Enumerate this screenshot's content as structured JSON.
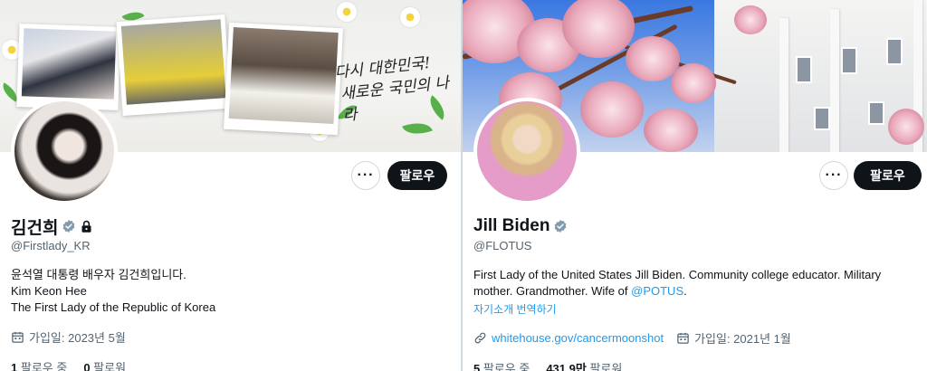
{
  "left_profile": {
    "banner": {
      "slogan_line1": "다시 대한민국!",
      "slogan_line2": "새로운 국민의 나라"
    },
    "follow_label": "팔로우",
    "more_label": "···",
    "name": "김건희",
    "handle": "@Firstlady_KR",
    "bio_line1": "윤석열 대통령 배우자 김건희입니다.",
    "bio_line2": "Kim Keon Hee",
    "bio_line3": "The First Lady of the Republic of Korea",
    "joined": "가입일: 2023년 5월",
    "following_count": "1",
    "following_label": "팔로우 중",
    "followers_count": "0",
    "followers_label": "팔로워"
  },
  "right_profile": {
    "follow_label": "팔로우",
    "more_label": "···",
    "name": "Jill Biden",
    "handle": "@FLOTUS",
    "bio_text": "First Lady of the United States Jill Biden. Community college educator. Military mother. Grandmother. Wife of ",
    "bio_mention": "@POTUS",
    "bio_end": ".",
    "translate_label": "자기소개 번역하기",
    "website": "whitehouse.gov/cancermoonshot",
    "joined": "가입일: 2021년 1월",
    "following_count": "5",
    "following_label": "팔로우 중",
    "followers_count": "431.9만",
    "followers_label": "팔로워"
  },
  "colors": {
    "accent": "#1d9bf0",
    "text_primary": "#0f1419",
    "text_secondary": "#536471",
    "button_dark": "#0f1419",
    "border": "#cfd9de",
    "verified_badge": "#829aab"
  },
  "icons": [
    "more-icon",
    "verified-badge-icon",
    "lock-icon",
    "calendar-icon",
    "link-icon"
  ]
}
